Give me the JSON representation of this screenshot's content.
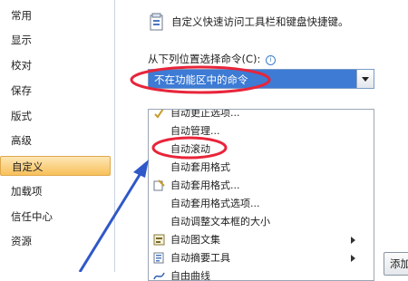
{
  "sidebar": {
    "items": [
      {
        "label": "常用",
        "active": false
      },
      {
        "label": "显示",
        "active": false
      },
      {
        "label": "校对",
        "active": false
      },
      {
        "label": "保存",
        "active": false
      },
      {
        "label": "版式",
        "active": false
      },
      {
        "label": "高级",
        "active": false
      },
      {
        "label": "自定义",
        "active": true
      },
      {
        "label": "加载项",
        "active": false
      },
      {
        "label": "信任中心",
        "active": false
      },
      {
        "label": "资源",
        "active": false
      }
    ]
  },
  "main": {
    "header_icon": "toolbar-customize-icon",
    "title": "自定义快速访问工具栏和键盘快捷键。",
    "choose_label": "从下列位置选择命令(C):",
    "info_icon": "info-icon",
    "dropdown_value": "不在功能区中的命令",
    "list_items": [
      {
        "label": "自动更正选项...",
        "icon": "autocorrect-icon",
        "submenu": false
      },
      {
        "label": "自动管理...",
        "icon": "",
        "submenu": false
      },
      {
        "label": "自动滚动",
        "icon": "",
        "submenu": false
      },
      {
        "label": "自动套用格式",
        "icon": "",
        "submenu": false
      },
      {
        "label": "自动套用格式...",
        "icon": "autoformat-icon",
        "submenu": false
      },
      {
        "label": "自动套用格式选项...",
        "icon": "",
        "submenu": false
      },
      {
        "label": "自动调整文本框的大小",
        "icon": "",
        "submenu": false
      },
      {
        "label": "自动图文集",
        "icon": "autotext-icon",
        "submenu": true
      },
      {
        "label": "自动摘要工具",
        "icon": "autosummary-icon",
        "submenu": true
      },
      {
        "label": "自由曲线",
        "icon": "freeform-icon",
        "submenu": false
      }
    ],
    "add_button": "添加"
  },
  "annotation_color": "#e8253a",
  "arrow_color": "#2f58c8",
  "accent_color": "#3d7bd4"
}
